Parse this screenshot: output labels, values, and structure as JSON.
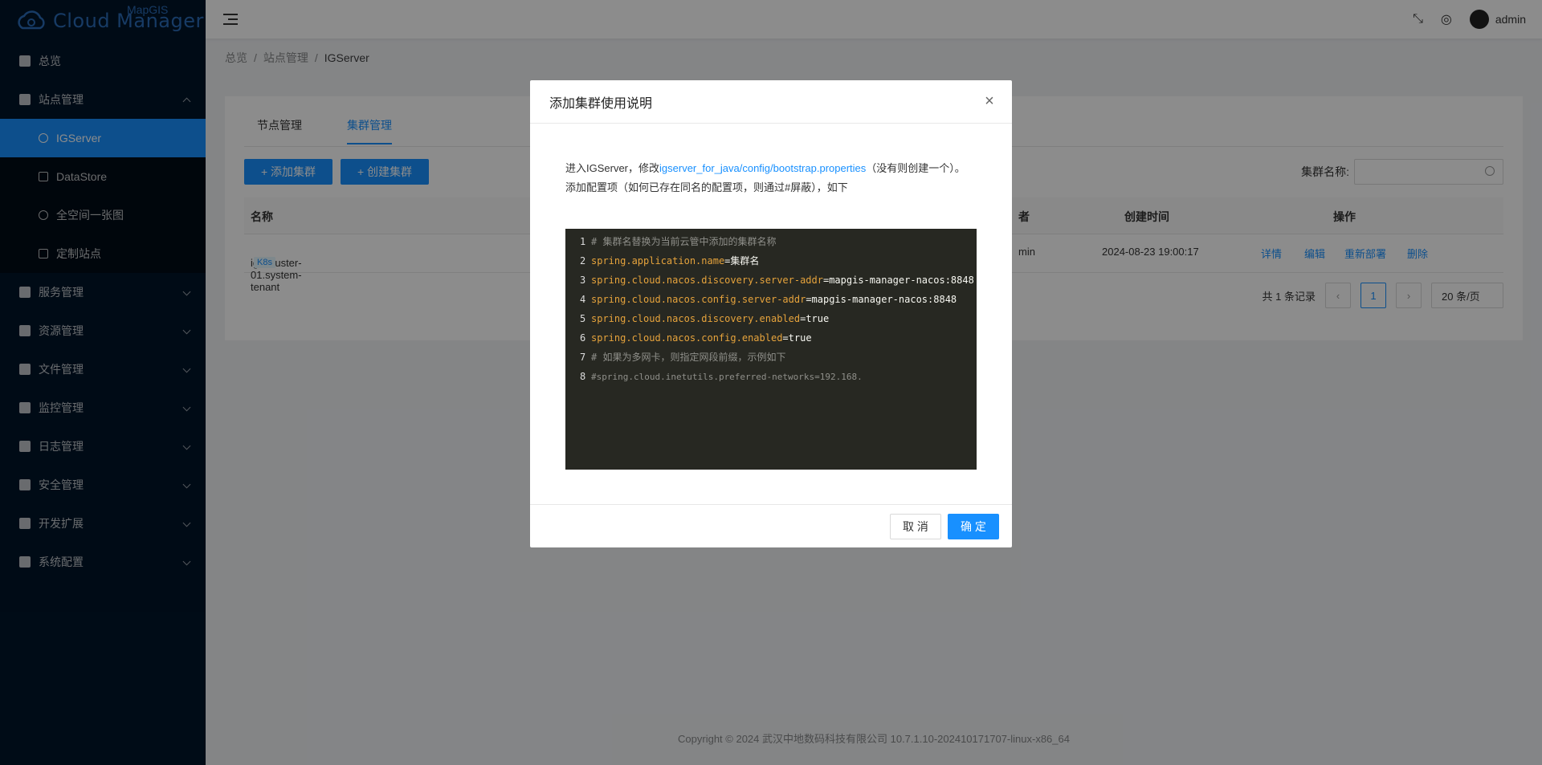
{
  "app": {
    "logo_text": "Cloud Manager",
    "logo_sup": "MapGIS"
  },
  "sidebar": {
    "items": [
      {
        "label": "总览",
        "icon": "dashboard-icon"
      },
      {
        "label": "站点管理",
        "icon": "site-icon",
        "expanded": true,
        "children": [
          {
            "label": "IGServer",
            "icon": "cloud-icon",
            "active": true
          },
          {
            "label": "DataStore",
            "icon": "datastore-icon"
          },
          {
            "label": "全空间一张图",
            "icon": "globe-icon"
          },
          {
            "label": "定制站点",
            "icon": "custom-site-icon"
          }
        ]
      },
      {
        "label": "服务管理",
        "icon": "service-icon"
      },
      {
        "label": "资源管理",
        "icon": "resource-icon"
      },
      {
        "label": "文件管理",
        "icon": "folder-icon"
      },
      {
        "label": "监控管理",
        "icon": "monitor-icon"
      },
      {
        "label": "日志管理",
        "icon": "log-icon"
      },
      {
        "label": "安全管理",
        "icon": "shield-icon"
      },
      {
        "label": "开发扩展",
        "icon": "pin-icon"
      },
      {
        "label": "系统配置",
        "icon": "gear-icon"
      }
    ]
  },
  "header": {
    "user": "admin"
  },
  "breadcrumb": [
    "总览",
    "站点管理",
    "IGServer"
  ],
  "tabs": [
    "节点管理",
    "集群管理"
  ],
  "toolbar": {
    "add_cluster": "+ 添加集群",
    "create_cluster": "+ 创建集群",
    "search_label": "集群名称:"
  },
  "table": {
    "columns": [
      "名称",
      "者",
      "创建时间",
      "操作"
    ],
    "rows": [
      {
        "name": "igs-cluster-01.system-tenant",
        "tag": "K8s",
        "owner": "min",
        "created": "2024-08-23 19:00:17",
        "actions": [
          "详情",
          "编辑",
          "重新部署",
          "删除"
        ]
      }
    ]
  },
  "pagination": {
    "total_text": "共 1 条记录",
    "current": "1",
    "page_size": "20 条/页"
  },
  "footer": "Copyright © 2024 武汉中地数码科技有限公司 10.7.1.10-202410171707-linux-x86_64",
  "modal": {
    "title": "添加集群使用说明",
    "intro_prefix": "进入IGServer，修改",
    "intro_link": "igserver_for_java/config/bootstrap.properties",
    "intro_suffix": "（没有则创建一个）。",
    "intro_line2": "添加配置项（如何已存在同名的配置项，则通过#屏蔽），如下",
    "code_lines": [
      {
        "n": "1",
        "comment": "# 集群名替换为当前云管中添加的集群名称"
      },
      {
        "n": "2",
        "key": "spring.application.name",
        "val": "=集群名"
      },
      {
        "n": "3",
        "key": "spring.cloud.nacos.discovery.server-addr",
        "val": "=mapgis-manager-nacos:8848"
      },
      {
        "n": "4",
        "key": "spring.cloud.nacos.config.server-addr",
        "val": "=mapgis-manager-nacos:8848"
      },
      {
        "n": "5",
        "key": "spring.cloud.nacos.discovery.enabled",
        "val": "=true"
      },
      {
        "n": "6",
        "key": "spring.cloud.nacos.config.enabled",
        "val": "=true"
      },
      {
        "n": "7",
        "comment": "# 如果为多网卡，则指定网段前缀，示例如下"
      },
      {
        "n": "8",
        "comment": "#spring.cloud.inetutils.preferred-networks=192.168."
      }
    ],
    "cancel": "取 消",
    "ok": "确 定"
  }
}
